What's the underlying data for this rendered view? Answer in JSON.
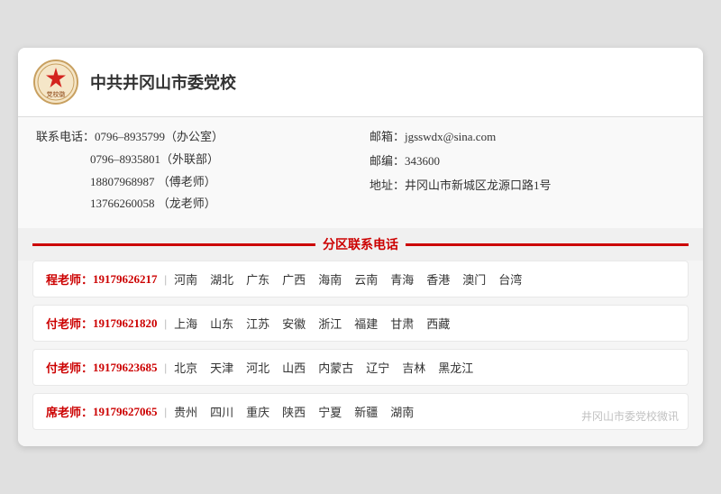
{
  "org": {
    "title": "中共井冈山市委党校",
    "logo_text": "党校"
  },
  "contact": {
    "phone_label": "联系电话：",
    "phone1": "0796–8935799（办公室）",
    "phone2": "0796–8935801（外联部）",
    "phone3": "18807968987 （傅老师）",
    "phone4": "13766260058 （龙老师）",
    "email_label": "邮箱：",
    "email_value": "jgsswdx@sina.com",
    "postcode_label": "邮编：",
    "postcode_value": "343600",
    "address_label": "地址：",
    "address_value": "井冈山市新城区龙源口路1号"
  },
  "section": {
    "title": "分区联系电话"
  },
  "districts": [
    {
      "teacher": "程老师：",
      "phone": "19179626217",
      "regions": [
        "河南",
        "湖北",
        "广东",
        "广西",
        "海南",
        "云南",
        "青海",
        "香港",
        "澳门",
        "台湾"
      ]
    },
    {
      "teacher": "付老师：",
      "phone": "19179621820",
      "regions": [
        "上海",
        "山东",
        "江苏",
        "安徽",
        "浙江",
        "福建",
        "甘肃",
        "西藏"
      ]
    },
    {
      "teacher": "付老师：",
      "phone": "19179623685",
      "regions": [
        "北京",
        "天津",
        "河北",
        "山西",
        "内蒙古",
        "辽宁",
        "吉林",
        "黑龙江"
      ]
    },
    {
      "teacher": "席老师：",
      "phone": "19179627065",
      "regions": [
        "贵州",
        "四川",
        "重庆",
        "陕西",
        "宁夏",
        "新疆",
        "湖南"
      ],
      "watermark": "井冈山市委党校微讯"
    }
  ]
}
